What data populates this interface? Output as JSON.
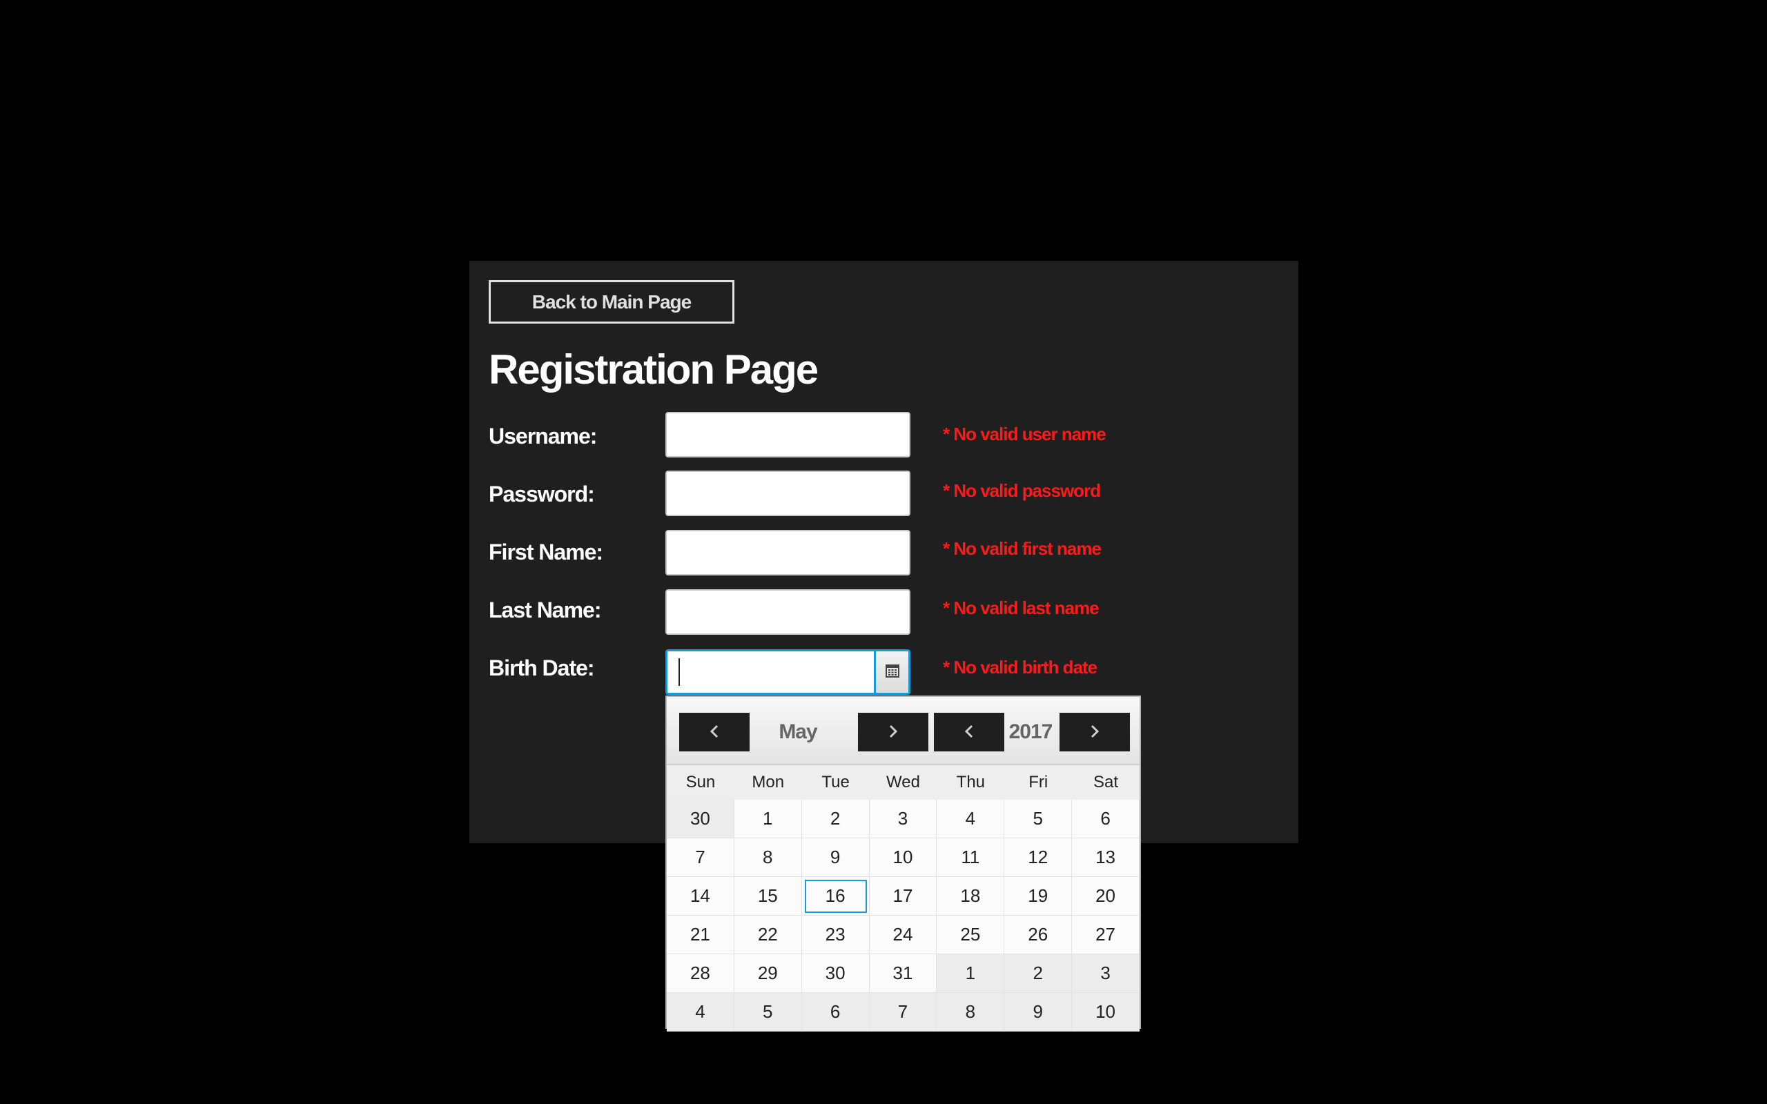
{
  "back_button_label": "Back to Main Page",
  "page_title": "Registration Page",
  "fields": [
    {
      "label": "Username:",
      "value": "",
      "error": "* No valid user name"
    },
    {
      "label": "Password:",
      "value": "",
      "error": "* No valid password"
    },
    {
      "label": "First Name:",
      "value": "",
      "error": "* No valid first name"
    },
    {
      "label": "Last Name:",
      "value": "",
      "error": "* No valid last name"
    },
    {
      "label": "Birth Date:",
      "value": "",
      "error": "* No valid birth date"
    }
  ],
  "calendar": {
    "month": "May",
    "year": "2017",
    "weekdays": [
      "Sun",
      "Mon",
      "Tue",
      "Wed",
      "Thu",
      "Fri",
      "Sat"
    ],
    "weeks": [
      [
        "30",
        "1",
        "2",
        "3",
        "4",
        "5",
        "6"
      ],
      [
        "7",
        "8",
        "9",
        "10",
        "11",
        "12",
        "13"
      ],
      [
        "14",
        "15",
        "16",
        "17",
        "18",
        "19",
        "20"
      ],
      [
        "21",
        "22",
        "23",
        "24",
        "25",
        "26",
        "27"
      ],
      [
        "28",
        "29",
        "30",
        "31",
        "1",
        "2",
        "3"
      ],
      [
        "4",
        "5",
        "6",
        "7",
        "8",
        "9",
        "10"
      ]
    ],
    "highlighted_day": "16",
    "icons": {
      "prev_month": "chevron-left-icon",
      "next_month": "chevron-right-icon",
      "prev_year": "chevron-left-icon",
      "next_year": "chevron-right-icon",
      "picker": "calendar-icon"
    }
  },
  "colors": {
    "background": "#000000",
    "panel": "#1f1f1f",
    "error": "#ff1a1a",
    "focus": "#1a9ad6",
    "nav_button": "#1f1f1f"
  }
}
